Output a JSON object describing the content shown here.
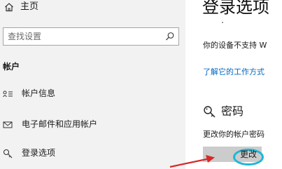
{
  "sidebar": {
    "home_label": "主页",
    "search": {
      "placeholder": "查找设置",
      "icon": "search-icon"
    },
    "section_heading": "帐户",
    "items": [
      {
        "label": "帐户信息",
        "icon": "person-card-icon"
      },
      {
        "label": "电子邮件和应用帐户",
        "icon": "mail-icon"
      },
      {
        "label": "登录选项",
        "icon": "key-icon"
      }
    ]
  },
  "main": {
    "title": "登录选项",
    "unsupported_text": "你的设备不支持 W",
    "learn_link": "了解它的工作方式",
    "password": {
      "heading": "密码",
      "description": "更改你的帐户密码",
      "button_label": "更改",
      "icon": "key-icon"
    }
  },
  "colors": {
    "sidebar_bg": "#f2f2f2",
    "link": "#0067c0",
    "highlight_circle": "#1fb6d6",
    "annotation_arrow": "#d42a2a",
    "button_bg": "#cccccc"
  }
}
